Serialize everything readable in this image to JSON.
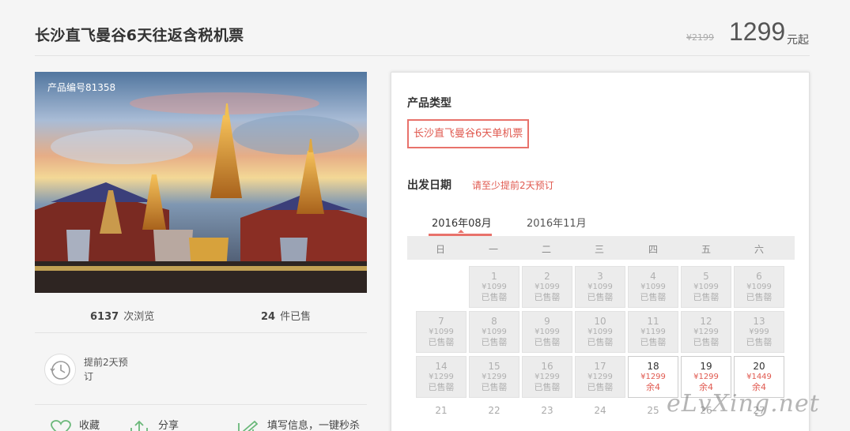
{
  "header": {
    "title": "长沙直飞曼谷6天往返含税机票",
    "price_original": "¥2199",
    "price_current": "1299",
    "price_unit": "元起"
  },
  "product": {
    "code_label": "产品编号81358",
    "views_count": "6137",
    "views_label": "次浏览",
    "sold_count": "24",
    "sold_label": "件已售",
    "advance_text": "提前2天预订"
  },
  "actions": {
    "favorite": "收藏",
    "share": "分享",
    "fill": "填写信息，一键秒杀"
  },
  "booking": {
    "product_type_label": "产品类型",
    "product_type_option": "长沙直飞曼谷6天单机票",
    "date_label": "出发日期",
    "date_hint": "请至少提前2天预订",
    "months": [
      "2016年08月",
      "2016年11月"
    ],
    "weekdays": [
      "日",
      "一",
      "二",
      "三",
      "四",
      "五",
      "六"
    ],
    "days": [
      {
        "day": "1",
        "price": "¥1099",
        "status": "已售罄"
      },
      {
        "day": "2",
        "price": "¥1099",
        "status": "已售罄"
      },
      {
        "day": "3",
        "price": "¥1099",
        "status": "已售罄"
      },
      {
        "day": "4",
        "price": "¥1099",
        "status": "已售罄"
      },
      {
        "day": "5",
        "price": "¥1099",
        "status": "已售罄"
      },
      {
        "day": "6",
        "price": "¥1099",
        "status": "已售罄"
      },
      {
        "day": "7",
        "price": "¥1099",
        "status": "已售罄"
      },
      {
        "day": "8",
        "price": "¥1099",
        "status": "已售罄"
      },
      {
        "day": "9",
        "price": "¥1099",
        "status": "已售罄"
      },
      {
        "day": "10",
        "price": "¥1099",
        "status": "已售罄"
      },
      {
        "day": "11",
        "price": "¥1199",
        "status": "已售罄"
      },
      {
        "day": "12",
        "price": "¥1299",
        "status": "已售罄"
      },
      {
        "day": "13",
        "price": "¥999",
        "status": "已售罄"
      },
      {
        "day": "14",
        "price": "¥1299",
        "status": "已售罄"
      },
      {
        "day": "15",
        "price": "¥1299",
        "status": "已售罄"
      },
      {
        "day": "16",
        "price": "¥1299",
        "status": "已售罄"
      },
      {
        "day": "17",
        "price": "¥1299",
        "status": "已售罄"
      },
      {
        "day": "18",
        "price": "¥1299",
        "status": "余4"
      },
      {
        "day": "19",
        "price": "¥1299",
        "status": "余4"
      },
      {
        "day": "20",
        "price": "¥1449",
        "status": "余4"
      },
      {
        "day": "21",
        "price": "",
        "status": ""
      },
      {
        "day": "22",
        "price": "",
        "status": ""
      },
      {
        "day": "23",
        "price": "",
        "status": ""
      },
      {
        "day": "24",
        "price": "",
        "status": ""
      },
      {
        "day": "25",
        "price": "",
        "status": ""
      },
      {
        "day": "26",
        "price": "",
        "status": ""
      },
      {
        "day": "27",
        "price": "",
        "status": ""
      }
    ]
  },
  "watermark": "eLvXing.net",
  "colors": {
    "accent": "#e8726b",
    "sold_bg": "#ececec"
  }
}
